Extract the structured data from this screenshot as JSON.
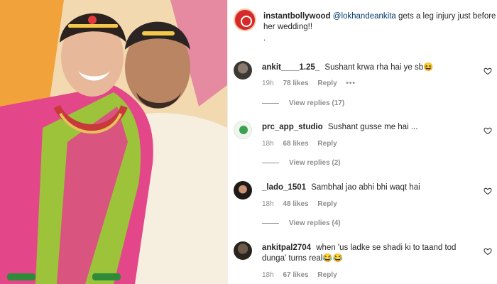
{
  "post": {
    "author": "instantbollywood",
    "mention": "@lokhandeankita",
    "caption": " gets a leg injury just before her wedding!!",
    "caption_dot": "."
  },
  "comments": [
    {
      "user": "ankit____1.25_",
      "text": "Sushant krwa rha hai ye sb😆",
      "time": "19h",
      "likes": "78 likes",
      "reply": "Reply",
      "more": "•••",
      "view_replies": "View replies (17)"
    },
    {
      "user": "prc_app_studio",
      "text": "Sushant gusse me hai ...",
      "time": "18h",
      "likes": "68 likes",
      "reply": "Reply",
      "view_replies": "View replies (2)"
    },
    {
      "user": "_lado_1501",
      "text": "Sambhal jao abhi bhi waqt hai",
      "time": "18h",
      "likes": "48 likes",
      "reply": "Reply",
      "view_replies": "View replies (4)"
    },
    {
      "user": "ankitpal2704",
      "text": "when 'us ladke se shadi ki to taand tod dunga' turns real😂😂",
      "time": "18h",
      "likes": "67 likes",
      "reply": "Reply"
    }
  ],
  "colors": {
    "username": "#262626",
    "mention": "#00376b",
    "meta": "#8e8e8e",
    "brand_red": "#d62a2a"
  },
  "icons": [
    "heart-icon",
    "more-options-icon"
  ]
}
